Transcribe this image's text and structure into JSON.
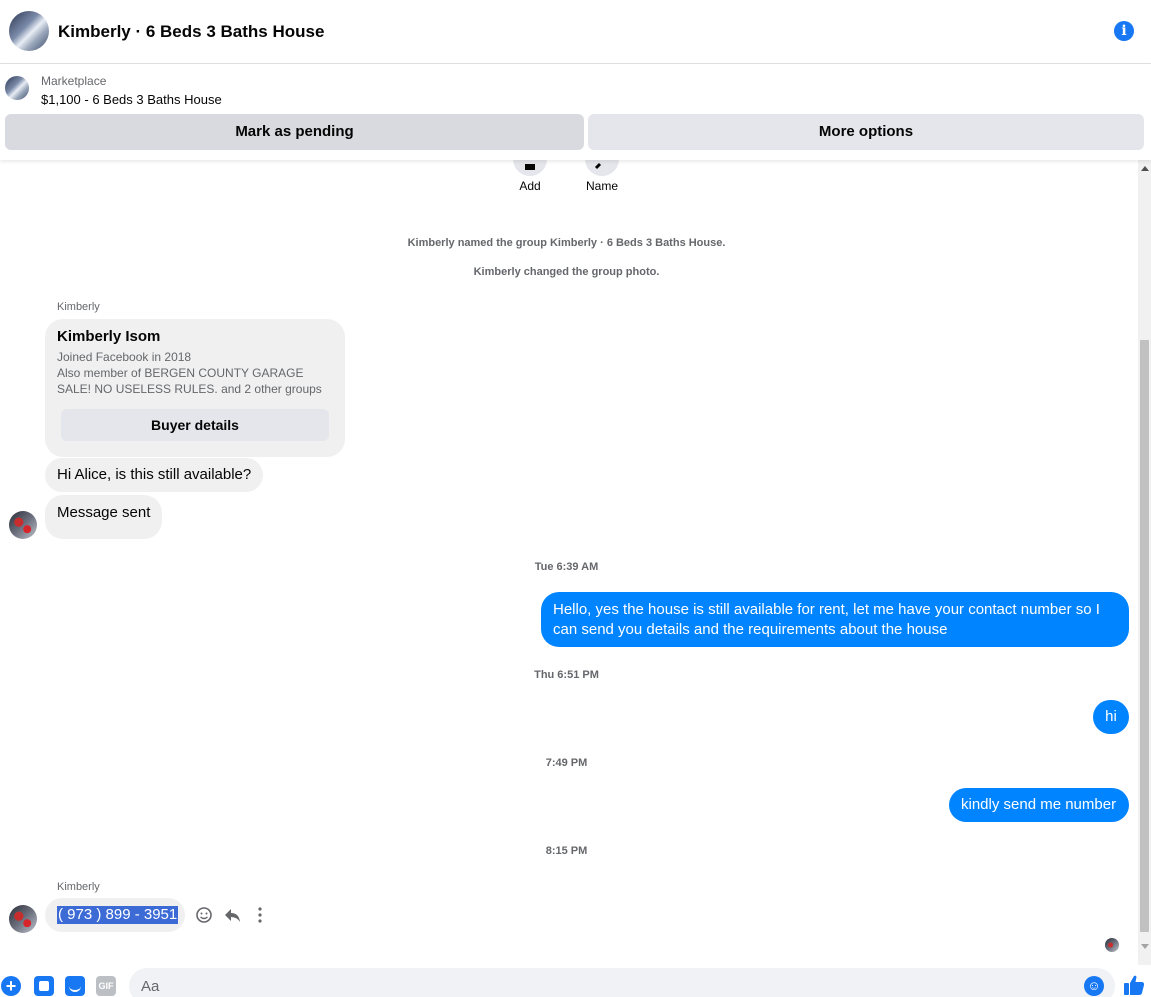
{
  "header": {
    "title": "Kimberly · 6 Beds 3 Baths House",
    "avatar": "house-photo-avatar",
    "info_icon": "info-icon",
    "info_glyph": "i"
  },
  "marketplace": {
    "label": "Marketplace",
    "listing": "$1,100 - 6 Beds 3 Baths House",
    "buttons": {
      "pending": "Mark as pending",
      "more": "More options"
    }
  },
  "top_actions": [
    {
      "label": "Add",
      "icon": "add-person-icon"
    },
    {
      "label": "Name",
      "icon": "pencil-icon"
    }
  ],
  "system_messages": [
    "Kimberly named the group Kimberly · 6 Beds 3 Baths House.",
    "Kimberly changed the group photo."
  ],
  "buyer_card": {
    "sender": "Kimberly",
    "name": "Kimberly Isom",
    "joined": "Joined Facebook in 2018",
    "groups": "Also member of BERGEN COUNTY GARAGE SALE! NO USELESS RULES. and 2 other groups",
    "button": "Buyer details"
  },
  "messages": {
    "in_1": "Hi Alice, is this still available?",
    "in_2": "Message sent",
    "ts_1": "Tue 6:39 AM",
    "out_1": "Hello, yes the house is still available for rent, let me have your contact number so I can send you details and the requirements about the house",
    "ts_2": "Thu 6:51 PM",
    "out_2": "hi",
    "ts_3": "7:49 PM",
    "out_3": "kindly send me number",
    "ts_4": "8:15 PM",
    "sender_2": "Kimberly",
    "phone": "( 973 ) 899 - 3951"
  },
  "composer": {
    "placeholder": "Aa",
    "plus_glyph": "+",
    "gif_label": "GIF",
    "emoji_glyph": "☺"
  },
  "colors": {
    "accent": "#1877f2",
    "outgoing_bubble": "#0084ff",
    "incoming_bubble": "#f0f0f0",
    "selection": "#3c6bd6"
  }
}
